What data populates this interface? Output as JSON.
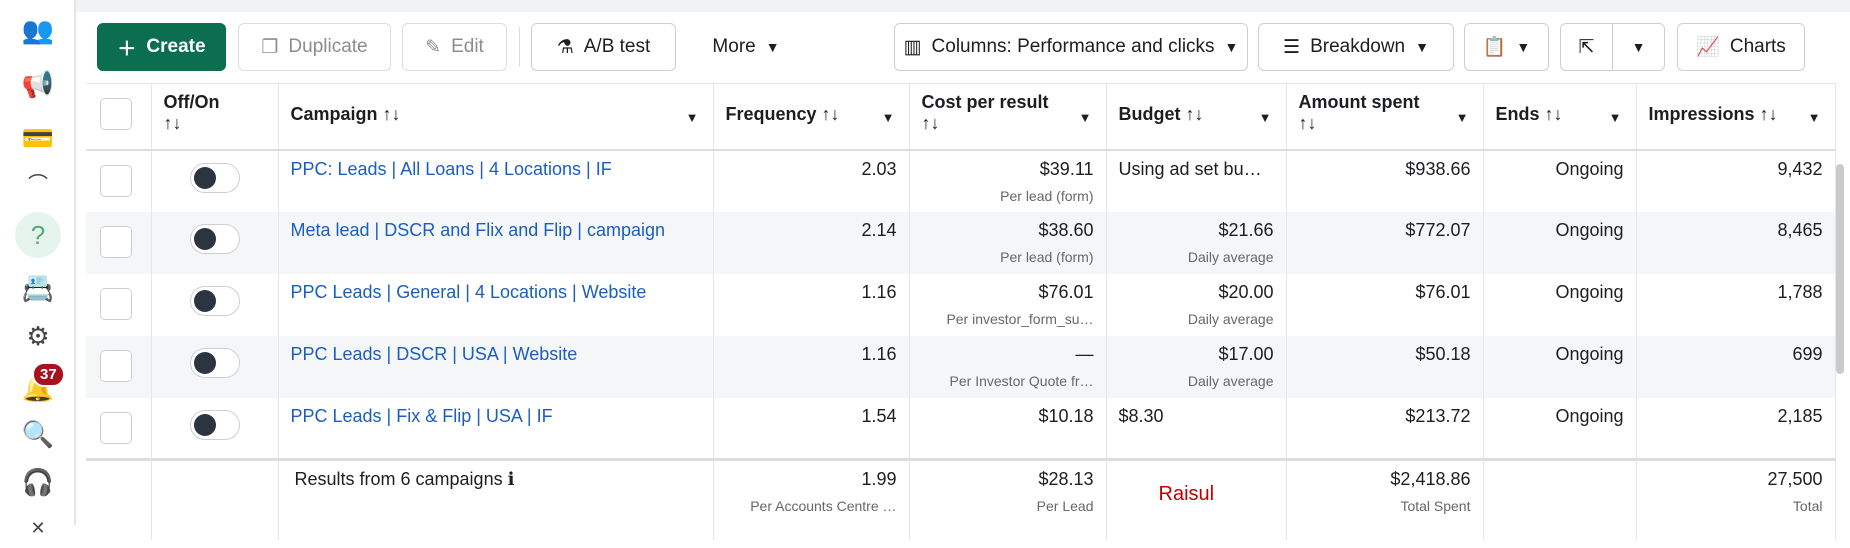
{
  "sidebar": {
    "badge_count": "37",
    "icons": [
      "people-icon",
      "megaphone-icon",
      "billing-card-icon",
      "collapse-icon",
      "help-icon",
      "contact-card-icon",
      "settings-icon",
      "notifications-bell-icon",
      "search-icon",
      "support-headset-icon",
      "close-icon"
    ]
  },
  "toolbar": {
    "create": "Create",
    "duplicate": "Duplicate",
    "edit": "Edit",
    "ab_test": "A/B test",
    "more": "More",
    "columns": "Columns: Performance and clicks",
    "breakdown": "Breakdown",
    "charts": "Charts"
  },
  "colors": {
    "primary": "#0a6e4f",
    "link": "#1a5ec2",
    "badge": "#a8121f"
  },
  "table": {
    "headers": {
      "toggle": "Off/On",
      "campaign": "Campaign",
      "frequency": "Frequency",
      "cost_per_result": "Cost per result",
      "budget": "Budget",
      "amount_spent": "Amount spent",
      "ends": "Ends",
      "impressions": "Impressions",
      "sort": "↑↓"
    },
    "rows": [
      {
        "campaign": "PPC: Leads | All Loans | 4 Locations | IF",
        "frequency": "2.03",
        "cost": "$39.11",
        "cost_sub": "Per lead (form)",
        "budget": "Using ad set bu…",
        "budget_sub": "",
        "spent": "$938.66",
        "ends": "Ongoing",
        "impressions": "9,432"
      },
      {
        "campaign": "Meta lead | DSCR and Flix and Flip | campaign",
        "frequency": "2.14",
        "cost": "$38.60",
        "cost_sub": "Per lead (form)",
        "budget": "$21.66",
        "budget_sub": "Daily average",
        "spent": "$772.07",
        "ends": "Ongoing",
        "impressions": "8,465"
      },
      {
        "campaign": "PPC Leads | General | 4 Locations | Website",
        "frequency": "1.16",
        "cost": "$76.01",
        "cost_sub": "Per investor_form_su…",
        "budget": "$20.00",
        "budget_sub": "Daily average",
        "spent": "$76.01",
        "ends": "Ongoing",
        "impressions": "1,788"
      },
      {
        "campaign": "PPC Leads | DSCR | USA | Website",
        "frequency": "1.16",
        "cost": "—",
        "cost_sub": "Per Investor Quote fr…",
        "budget": "$17.00",
        "budget_sub": "Daily average",
        "spent": "$50.18",
        "ends": "Ongoing",
        "impressions": "699"
      },
      {
        "campaign": "PPC Leads | Fix & Flip | USA | IF",
        "frequency": "1.54",
        "cost": "$10.18",
        "cost_sub": "",
        "budget": "$8.30",
        "budget_sub": "",
        "spent": "$213.72",
        "ends": "Ongoing",
        "impressions": "2,185"
      }
    ],
    "footer": {
      "label": "Results from 6 campaigns",
      "frequency": "1.99",
      "frequency_sub": "Per Accounts Centre …",
      "cost": "$28.13",
      "cost_sub": "Per Lead",
      "budget_note": "Raisul",
      "spent": "$2,418.86",
      "spent_sub": "Total Spent",
      "impressions": "27,500",
      "impressions_sub": "Total"
    }
  }
}
